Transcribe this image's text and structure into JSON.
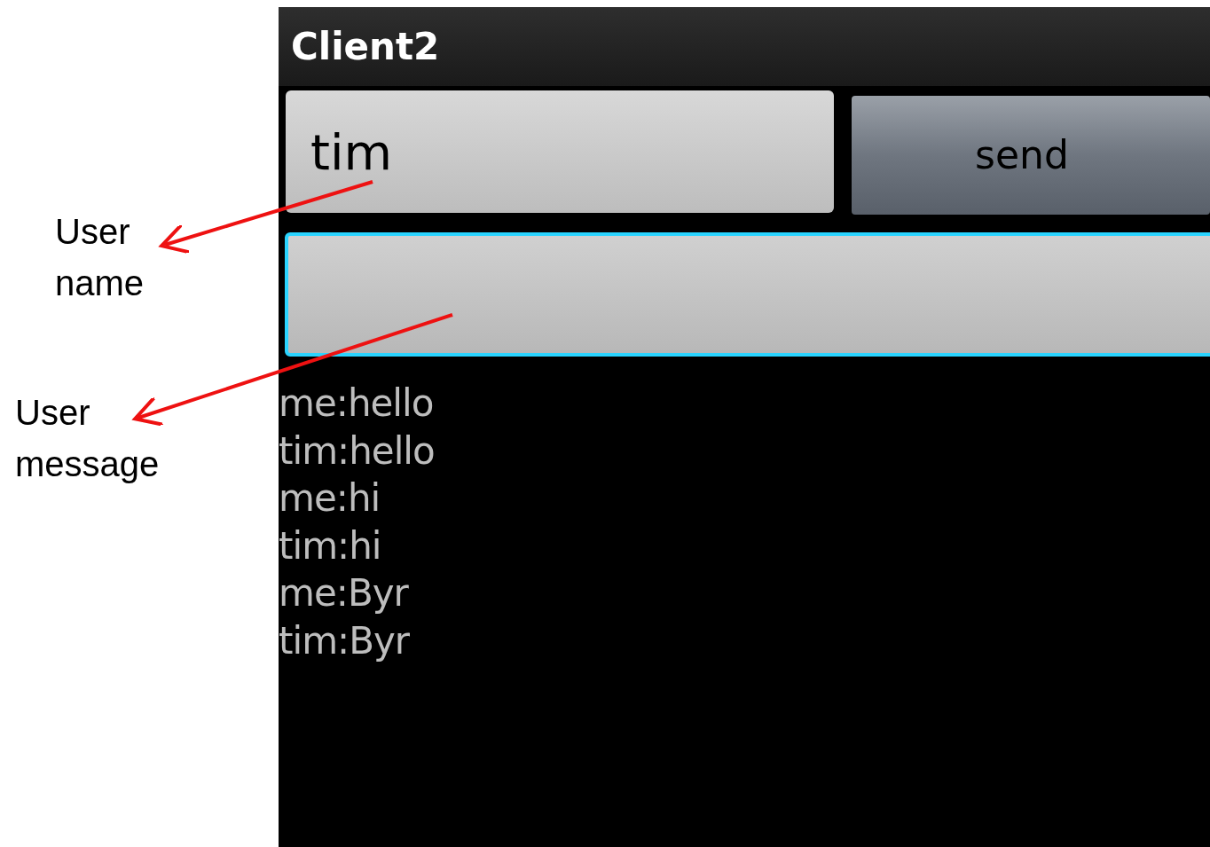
{
  "annotations": [
    {
      "text": "User name"
    },
    {
      "text": "User message"
    }
  ],
  "app": {
    "title": "Client2",
    "name_field": {
      "value": "tim"
    },
    "send_button": "send",
    "message_field": {
      "focused": true
    },
    "messages": [
      "me:hello",
      "tim:hello",
      "me:hi",
      "tim:hi",
      "me:Byr",
      "tim:Byr"
    ]
  }
}
